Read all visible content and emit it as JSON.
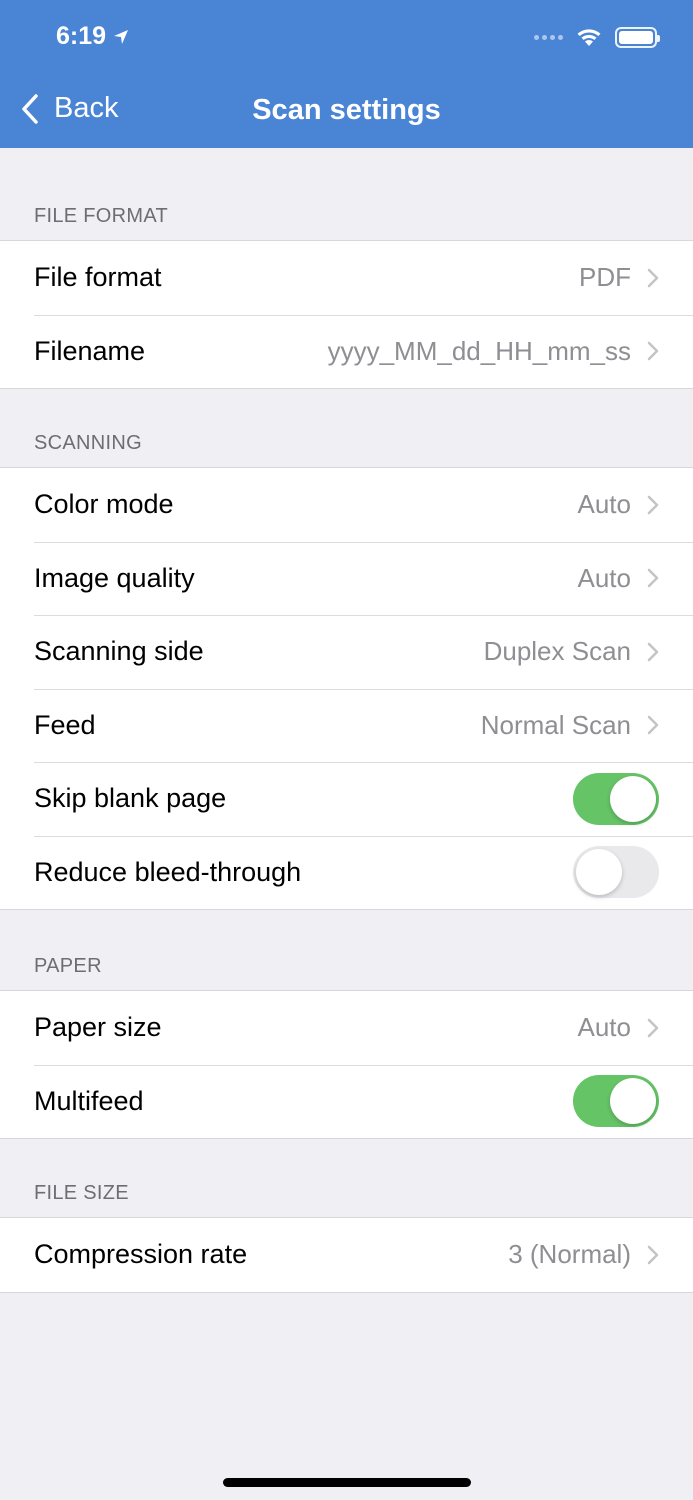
{
  "status_bar": {
    "time": "6:19"
  },
  "nav": {
    "back_label": "Back",
    "title": "Scan settings"
  },
  "sections": {
    "file_format": {
      "header": "FILE FORMAT",
      "file_format": {
        "label": "File format",
        "value": "PDF"
      },
      "filename": {
        "label": "Filename",
        "value": "yyyy_MM_dd_HH_mm_ss"
      }
    },
    "scanning": {
      "header": "SCANNING",
      "color_mode": {
        "label": "Color mode",
        "value": "Auto"
      },
      "image_quality": {
        "label": "Image quality",
        "value": "Auto"
      },
      "scanning_side": {
        "label": "Scanning side",
        "value": "Duplex Scan"
      },
      "feed": {
        "label": "Feed",
        "value": "Normal Scan"
      },
      "skip_blank_page": {
        "label": "Skip blank page",
        "on": true
      },
      "reduce_bleed_through": {
        "label": "Reduce bleed-through",
        "on": false
      }
    },
    "paper": {
      "header": "PAPER",
      "paper_size": {
        "label": "Paper size",
        "value": "Auto"
      },
      "multifeed": {
        "label": "Multifeed",
        "on": true
      }
    },
    "file_size": {
      "header": "FILE SIZE",
      "compression_rate": {
        "label": "Compression rate",
        "value": "3 (Normal)"
      }
    }
  },
  "colors": {
    "nav_bar": "#4a84d4",
    "toggle_on": "#65c466",
    "toggle_off": "#e9e9eb",
    "background": "#efeff4"
  }
}
